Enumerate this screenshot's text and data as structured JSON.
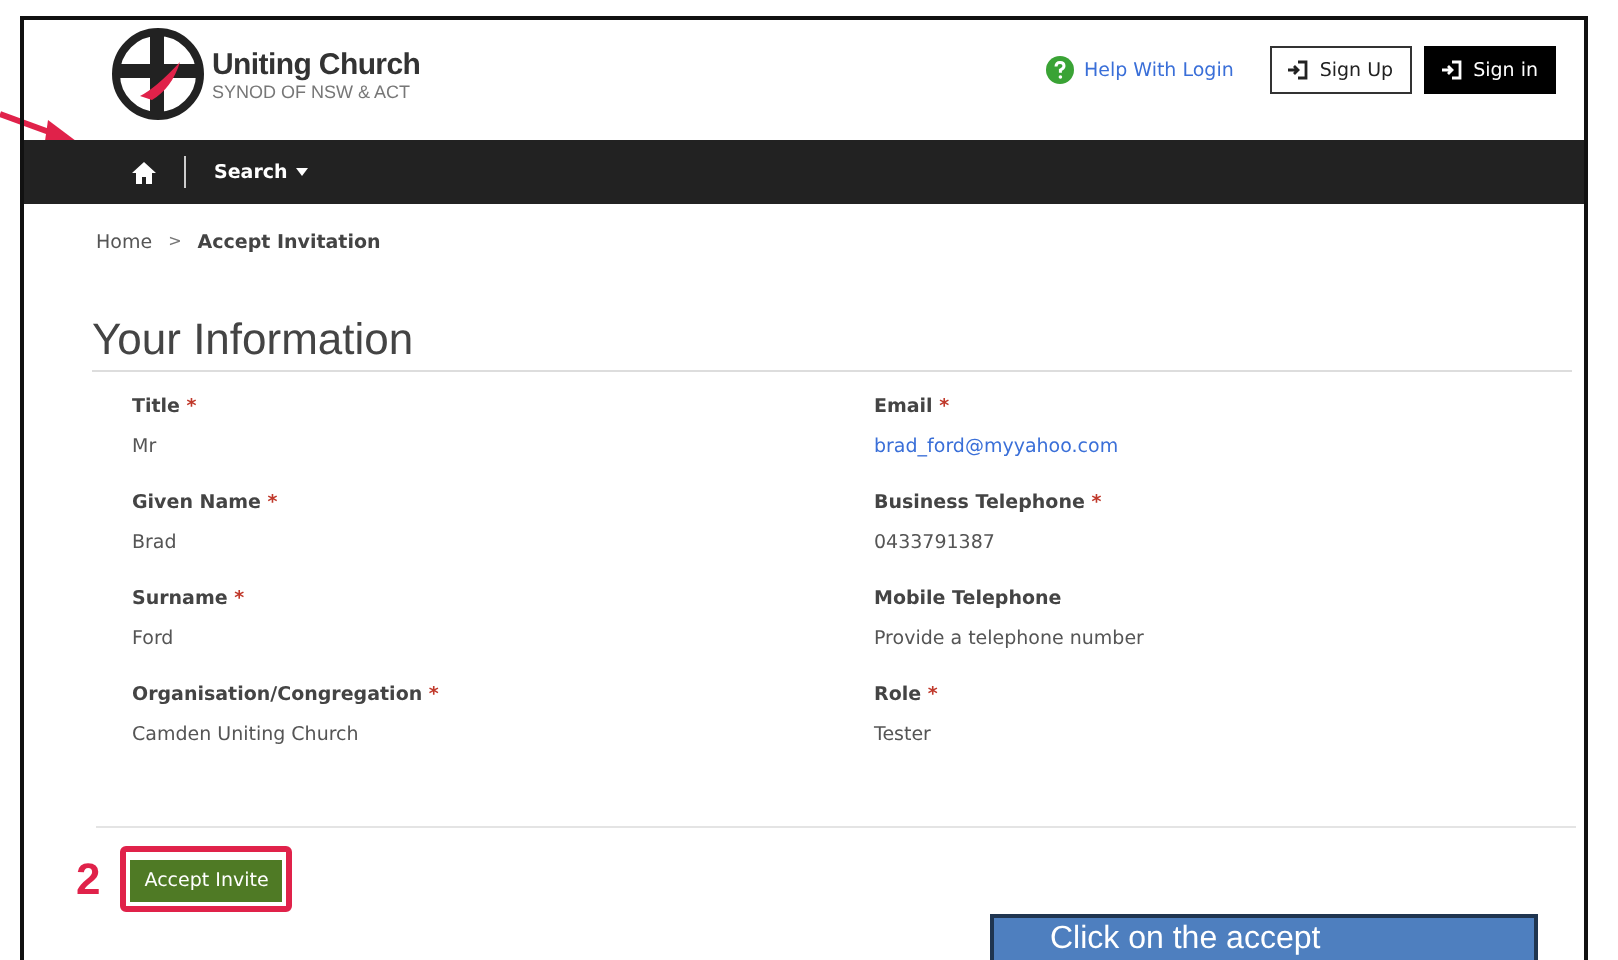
{
  "header": {
    "logo_name": "Uniting Church",
    "logo_sub": "SYNOD OF NSW & ACT",
    "help_link": "Help With Login",
    "buttons": [
      {
        "label": "Sign Up",
        "kind": "outline"
      },
      {
        "label": "Sign in",
        "kind": "solid"
      }
    ]
  },
  "nav": {
    "items": [
      {
        "label": "Search"
      }
    ]
  },
  "breadcrumb": {
    "separator": ">",
    "items": [
      {
        "label": "Home",
        "current": false
      },
      {
        "label": "Accept Invitation",
        "current": true
      }
    ]
  },
  "section_title": "Your Information",
  "fields": [
    {
      "label": "Title",
      "required_mark": "*",
      "value": "Mr",
      "kind": "text"
    },
    {
      "label": "Email",
      "required_mark": "*",
      "value": "brad_ford@myyahoo.com",
      "kind": "link"
    },
    {
      "label": "Given Name",
      "required_mark": "*",
      "value": "Brad",
      "kind": "text"
    },
    {
      "label": "Business Telephone",
      "required_mark": "*",
      "value": "0433791387",
      "kind": "text"
    },
    {
      "label": "Surname",
      "required_mark": "*",
      "value": "Ford",
      "kind": "text"
    },
    {
      "label": "Mobile Telephone",
      "value": "Provide a telephone number",
      "kind": "text"
    },
    {
      "label": "Organisation/Congregation",
      "required_mark": "*",
      "value": "Camden Uniting Church",
      "kind": "text"
    },
    {
      "label": "Role",
      "required_mark": "*",
      "value": "Tester",
      "kind": "text"
    }
  ],
  "accept_button": "Accept Invite",
  "annotation": {
    "step": "2",
    "callout": "Click on the accept"
  }
}
